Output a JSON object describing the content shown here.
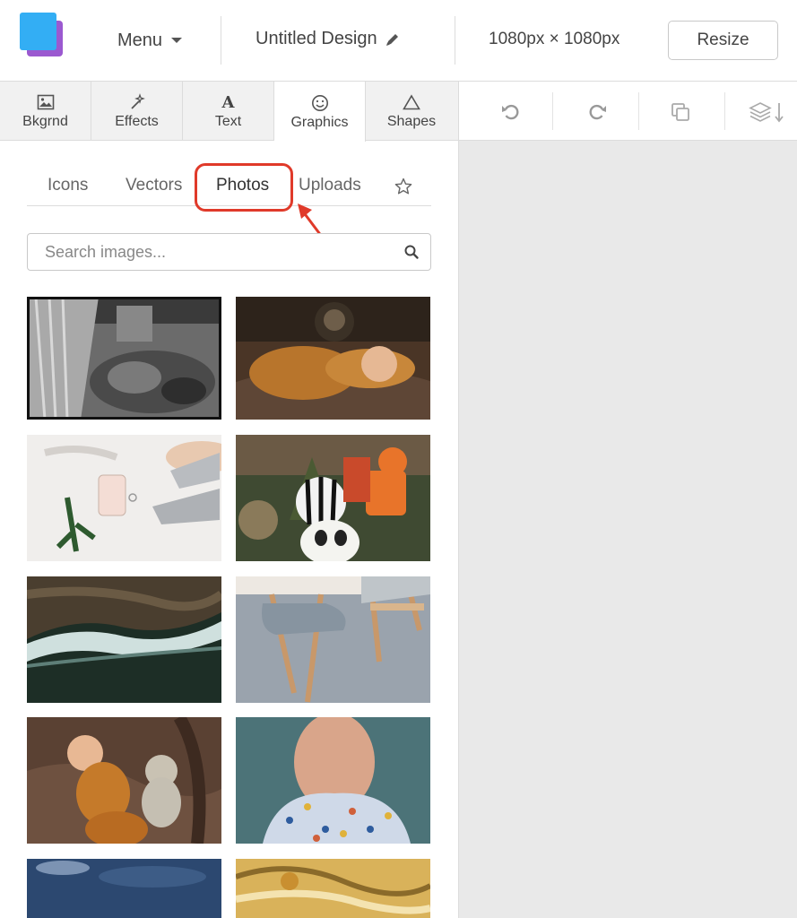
{
  "header": {
    "menu_label": "Menu",
    "design_title": "Untitled Design",
    "dimensions": "1080px × 1080px",
    "resize_label": "Resize"
  },
  "tool_tabs": [
    {
      "label": "Bkgrnd",
      "icon": "image-icon"
    },
    {
      "label": "Effects",
      "icon": "magic-wand-icon"
    },
    {
      "label": "Text",
      "icon": "text-icon",
      "glyph": "A"
    },
    {
      "label": "Graphics",
      "icon": "smiley-icon",
      "active": true
    },
    {
      "label": "Shapes",
      "icon": "triangle-icon"
    }
  ],
  "right_toolbar": [
    "undo-icon",
    "redo-icon",
    "duplicate-icon",
    "layers-icon"
  ],
  "sub_tabs": [
    {
      "label": "Icons"
    },
    {
      "label": "Vectors"
    },
    {
      "label": "Photos",
      "active": true
    },
    {
      "label": "Uploads"
    },
    {
      "label": "",
      "icon": "star-icon"
    }
  ],
  "search": {
    "placeholder": "Search images...",
    "value": ""
  },
  "colors": {
    "accent_highlight": "#e03a2a",
    "logo_blue": "#33aef4",
    "logo_purple": "#9b59d0",
    "canvas_bg": "#e9e9e9"
  },
  "photos": [
    {
      "subject": "black-and-white garden"
    },
    {
      "subject": "baby sleeping"
    },
    {
      "subject": "heels and perfume"
    },
    {
      "subject": "halloween decor"
    },
    {
      "subject": "coastal waves aerial"
    },
    {
      "subject": "chairs on rug"
    },
    {
      "subject": "baby with plush toy"
    },
    {
      "subject": "woman floral dress"
    },
    {
      "subject": "dark sky"
    },
    {
      "subject": "golden marble"
    }
  ]
}
